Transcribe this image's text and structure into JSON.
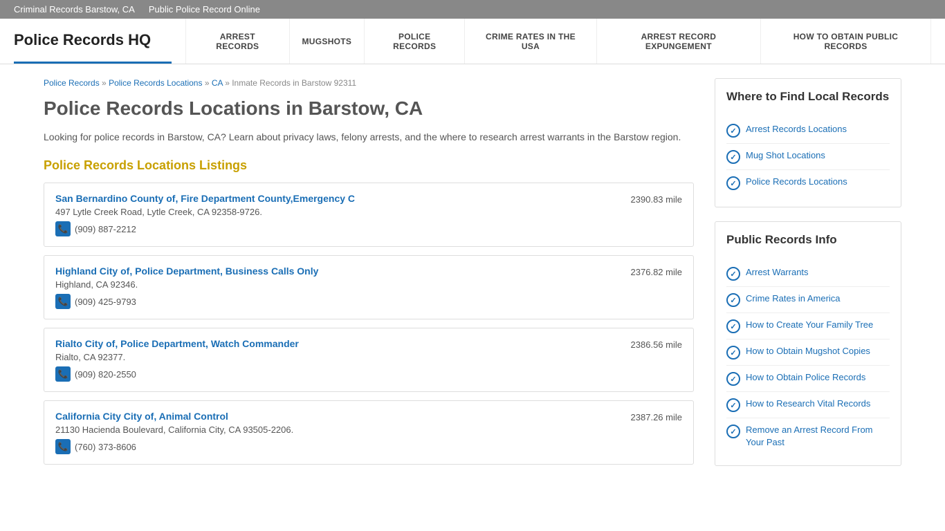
{
  "topbar": {
    "links": [
      {
        "label": "Criminal Records Barstow, CA"
      },
      {
        "label": "Public Police Record Online"
      }
    ]
  },
  "header": {
    "logo": "Police Records HQ",
    "nav": [
      {
        "label": "ARREST RECORDS"
      },
      {
        "label": "MUGSHOTS"
      },
      {
        "label": "POLICE RECORDS"
      },
      {
        "label": "CRIME RATES IN THE USA"
      },
      {
        "label": "ARREST RECORD EXPUNGEMENT"
      },
      {
        "label": "HOW TO OBTAIN PUBLIC RECORDS"
      }
    ]
  },
  "breadcrumb": {
    "items": [
      {
        "label": "Police Records",
        "href": true
      },
      {
        "label": "Police Records Locations",
        "href": true
      },
      {
        "label": "CA",
        "href": true
      },
      {
        "label": "Inmate Records in Barstow 92311",
        "href": false
      }
    ]
  },
  "page": {
    "title": "Police Records Locations in Barstow, CA",
    "description": "Looking for police records in Barstow, CA? Learn about privacy laws, felony arrests, and the where to research arrest warrants in the Barstow region.",
    "listings_heading": "Police Records Locations Listings"
  },
  "listings": [
    {
      "name": "San Bernardino County of, Fire Department County,Emergency C",
      "address": "497 Lytle Creek Road, Lytle Creek, CA 92358-9726.",
      "phone": "(909) 887-2212",
      "distance": "2390.83 mile"
    },
    {
      "name": "Highland City of, Police Department, Business Calls Only",
      "address": "Highland, CA 92346.",
      "phone": "(909) 425-9793",
      "distance": "2376.82 mile"
    },
    {
      "name": "Rialto City of, Police Department, Watch Commander",
      "address": "Rialto, CA 92377.",
      "phone": "(909) 820-2550",
      "distance": "2386.56 mile"
    },
    {
      "name": "California City City of, Animal Control",
      "address": "21130 Hacienda Boulevard, California City, CA 93505-2206.",
      "phone": "(760) 373-8606",
      "distance": "2387.26 mile"
    }
  ],
  "sidebar": {
    "find_local": {
      "title": "Where to Find Local Records",
      "links": [
        {
          "label": "Arrest Records Locations"
        },
        {
          "label": "Mug Shot Locations"
        },
        {
          "label": "Police Records Locations"
        }
      ]
    },
    "public_info": {
      "title": "Public Records Info",
      "links": [
        {
          "label": "Arrest Warrants"
        },
        {
          "label": "Crime Rates in America"
        },
        {
          "label": "How to Create Your Family Tree"
        },
        {
          "label": "How to Obtain Mugshot Copies"
        },
        {
          "label": "How to Obtain Police Records"
        },
        {
          "label": "How to Research Vital Records"
        },
        {
          "label": "Remove an Arrest Record From Your Past"
        }
      ]
    }
  }
}
